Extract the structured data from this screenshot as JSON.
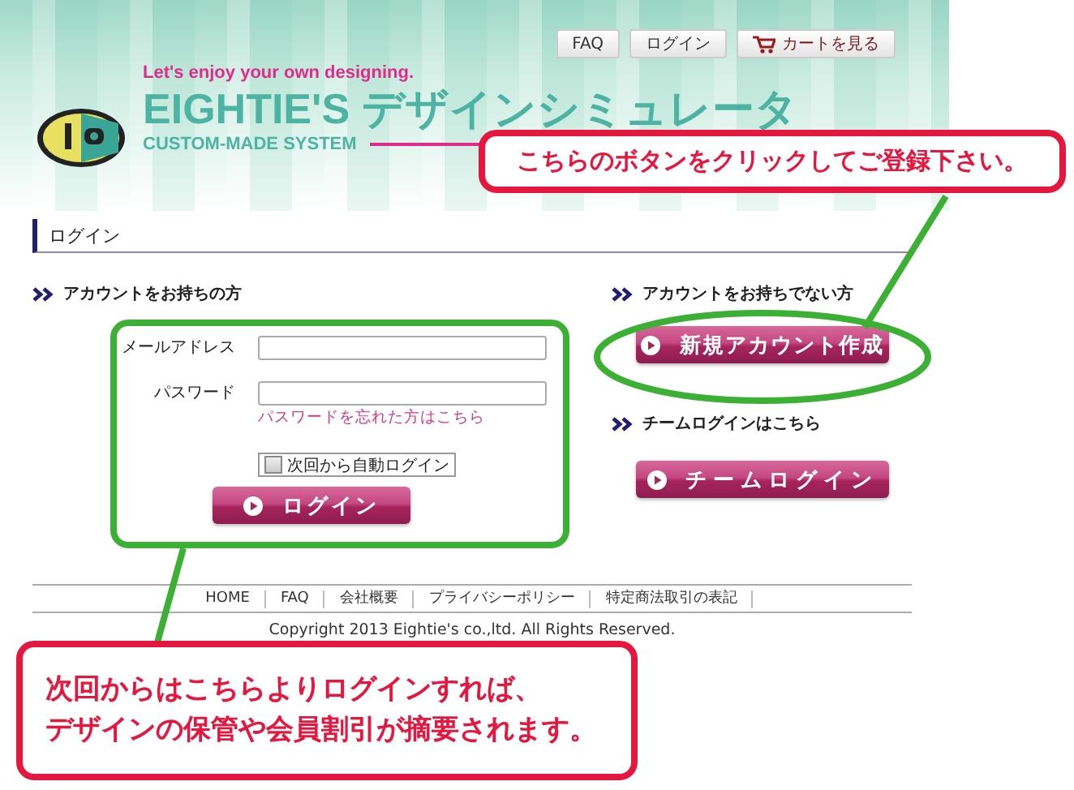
{
  "header": {
    "nav": [
      {
        "label": "FAQ",
        "kind": "plain"
      },
      {
        "label": "ログイン",
        "kind": "plain"
      },
      {
        "label": "カートを見る",
        "kind": "cart"
      }
    ],
    "tagline": "Let's enjoy your own designing.",
    "title": "EIGHTIE'S デザインシミュレータ",
    "subtitle": "CUSTOM-MADE SYSTEM"
  },
  "page_title": "ログイン",
  "member": {
    "heading": "アカウントをお持ちの方",
    "fields": [
      {
        "label": "メールアドレス"
      },
      {
        "label": "パスワード"
      }
    ],
    "forgot_link": "パスワードを忘れた方はこちら",
    "auto_login": {
      "label": "次回から自動ログイン",
      "checked": false
    },
    "button": "ログイン"
  },
  "new_user": {
    "heading": "アカウントをお持ちでない方",
    "button": "新規アカウント作成"
  },
  "team": {
    "heading": "チームログインはこちら",
    "button": "チームログイン"
  },
  "footer": {
    "links": [
      "HOME",
      "FAQ",
      "会社概要",
      "プライバシーポリシー",
      "特定商法取引の表記"
    ],
    "copyright": "Copyright 2013 Eightie's co.,ltd. All Rights Reserved."
  },
  "annotations": [
    {
      "lines": [
        "こちらのボタンをクリックしてご登録下さい。"
      ]
    },
    {
      "lines": [
        "次回からはこちらよりログインすれば、",
        "デザインの保管や会員割引が摘要されます。"
      ]
    }
  ]
}
